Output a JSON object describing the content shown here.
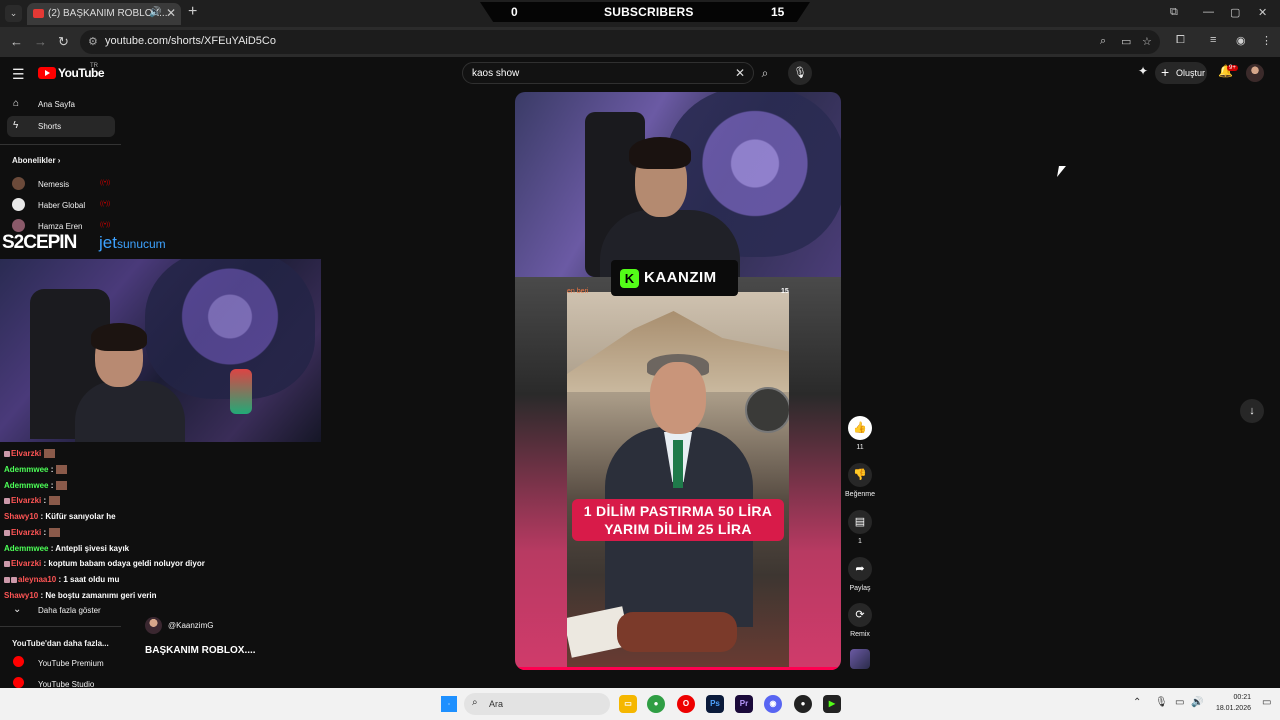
{
  "browser": {
    "tab_title": "(2) BAŞKANIM ROBLOX...",
    "url": "youtube.com/shorts/XFEuYAiD5Co"
  },
  "stream_bar": {
    "left": "0",
    "center": "SUBSCRIBERS",
    "right": "15"
  },
  "youtube": {
    "logo": "YouTube",
    "region": "TR",
    "search_value": "kaos show",
    "create_label": "Oluştur",
    "notif_count": "9+"
  },
  "sidebar": {
    "items": [
      {
        "label": "Ana Sayfa",
        "icon": "home-icon"
      },
      {
        "label": "Shorts",
        "icon": "shorts-icon"
      }
    ],
    "subs_heading": "Abonelikler",
    "subscriptions": [
      {
        "name": "Nemesis",
        "live": "((•))"
      },
      {
        "name": "Haber Global",
        "live": "((•))"
      },
      {
        "name": "Hamza Eren",
        "live": "((•))"
      }
    ],
    "show_more": "Daha fazla göster",
    "more_heading": "YouTube'dan daha fazla...",
    "more_items": [
      "YouTube Premium",
      "YouTube Studio"
    ]
  },
  "overlay": {
    "sponsor1": "S2CEPIN",
    "sponsor2_a": "jet",
    "sponsor2_b": "sunucum",
    "chat": [
      {
        "user": "Elvarzki",
        "msg": "",
        "color": "red"
      },
      {
        "user": "Ademmwee",
        "msg": ":",
        "color": "green"
      },
      {
        "user": "Ademmwee",
        "msg": ":",
        "color": "green"
      },
      {
        "user": "Elvarzki",
        "msg": ":",
        "color": "red"
      },
      {
        "user": "Shawy10",
        "msg": ": Küfür sanıyolar he",
        "color": "red"
      },
      {
        "user": "Elvarzki",
        "msg": ":",
        "color": "red"
      },
      {
        "user": "Ademmwee",
        "msg": ": Antepli şivesi kayık",
        "color": "green"
      },
      {
        "user": "Elvarzki",
        "msg": ": koptum babam odaya geldi noluyor diyor",
        "color": "red"
      },
      {
        "user": "aleynaa10",
        "msg": ": 1 saat oldu mu",
        "color": "red"
      },
      {
        "user": "Shawy10",
        "msg": ": Ne boştu zamanımı geri verin",
        "color": "red"
      }
    ]
  },
  "short": {
    "streamer_tag": "KAANZIM",
    "inner_top_left": "en beri",
    "inner_top_right": "15",
    "caption_line1": "1 DİLİM PASTIRMA 50 LİRA",
    "caption_line2": "YARIM DİLİM 25 LİRA",
    "channel_handle": "@KaanzimG",
    "title": "BAŞKANIM ROBLOX....",
    "progress": 1.0
  },
  "actions": {
    "like_count": "11",
    "dislike_label": "Beğenme",
    "comment_count": "1",
    "share_label": "Paylaş",
    "remix_label": "Remix"
  },
  "taskbar": {
    "search_label": "Ara",
    "time": "00:21",
    "date": "18.01.2026"
  }
}
